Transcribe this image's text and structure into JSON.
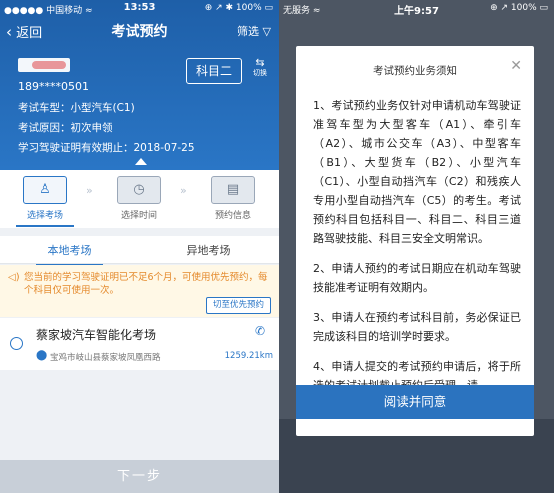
{
  "left_screen": {
    "status_bar": {
      "carrier": "●●●●● 中国移动 ≈",
      "time": "13:53",
      "battery": "⊕ ↗ ✱ 100% ▭"
    },
    "nav": {
      "back_label": "返回",
      "title": "考试预约",
      "filter_label": "筛选"
    },
    "user": {
      "phone": "189****0501",
      "vehicle_type": "考试车型：小型汽车(C1)",
      "exam_reason": "考试原因：初次申领",
      "permit_valid": "学习驾驶证明有效期止：2018-07-25",
      "subject": "科目二",
      "switch_label": "切换"
    },
    "steps": [
      {
        "label": "选择考场",
        "icon": "person-icon"
      },
      {
        "label": "选择时间",
        "icon": "clock-icon"
      },
      {
        "label": "预约信息",
        "icon": "document-icon"
      }
    ],
    "tabs": {
      "local": "本地考场",
      "remote": "异地考场"
    },
    "notice": {
      "text": "您当前的学习驾驶证明已不足6个月，可使用优先预约，每个科目仅可使用一次。",
      "button": "切至优先预约"
    },
    "site": {
      "name": "蔡家坡汽车智能化考场",
      "address": "宝鸡市岐山县蔡家坡凤凰西路",
      "distance": "1259.21km"
    },
    "next_button": "下一步"
  },
  "right_screen": {
    "status_bar": {
      "carrier": "无服务 ≈",
      "time": "上午9:57",
      "battery": "⊕ ↗ 100% ▭"
    },
    "dialog": {
      "title": "考试预约业务须知",
      "paragraphs": [
        "1、考试预约业务仅针对申请机动车驾驶证准驾车型为大型客车（A1）、牵引车（A2）、城市公交车（A3）、中型客车（B1）、大型货车（B2）、小型汽车（C1）、小型自动挡汽车（C2）和残疾人专用小型自动挡汽车（C5）的考生。考试预约科目包括科目一、科目二、科目三道路驾驶技能、科目三安全文明常识。",
        "2、申请人预约的考试日期应在机动车驾驶技能准考证明有效期内。",
        "3、申请人在预约考试科目前，务必保证已完成该科目的培训学时要求。",
        "4、申请人提交的考试预约申请后，将于所选的考试计划截止预约后受理，请"
      ],
      "agree_button": "阅读并同意"
    }
  },
  "colors": {
    "primary": "#2a76c6",
    "warning": "#e4892b",
    "disabled": "#c8cfd8"
  }
}
